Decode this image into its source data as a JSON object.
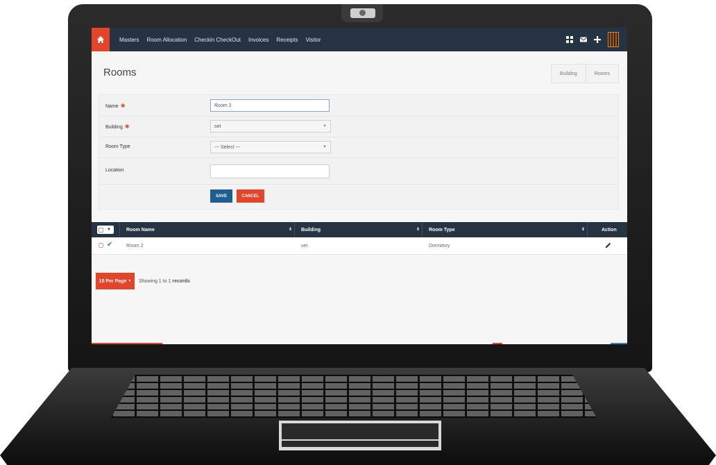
{
  "nav": {
    "items": [
      "Masters",
      "Room Allocation",
      "Checkin CheckOut",
      "Invoices",
      "Receipts",
      "Visitor"
    ],
    "right_icons": [
      "grid-icon",
      "mail-icon",
      "plus-icon"
    ]
  },
  "page": {
    "title": "Rooms",
    "breadcrumb": [
      "Building",
      "Rooms"
    ]
  },
  "form": {
    "name": {
      "label": "Name",
      "value": "Room 2",
      "required": true
    },
    "building": {
      "label": "Building",
      "value": "set",
      "required": true
    },
    "room_type": {
      "label": "Room Type",
      "value": "--- Select ---",
      "required": false
    },
    "location": {
      "label": "Location",
      "value": "",
      "required": false
    },
    "save_label": "SAVE",
    "cancel_label": "CANCEL"
  },
  "table": {
    "columns": [
      "Room Name",
      "Building",
      "Room Type",
      "Action"
    ],
    "rows": [
      {
        "room_name": "Room 2",
        "building": "set",
        "room_type": "Dormitory",
        "checked": true
      }
    ]
  },
  "pagination": {
    "per_page": "15 Per Page",
    "showing_prefix": "Showing 1 to 1",
    "showing_suffix": "records"
  },
  "colors": {
    "accent": "#e2452a",
    "nav_bg": "#253342",
    "primary": "#1f5d92"
  }
}
